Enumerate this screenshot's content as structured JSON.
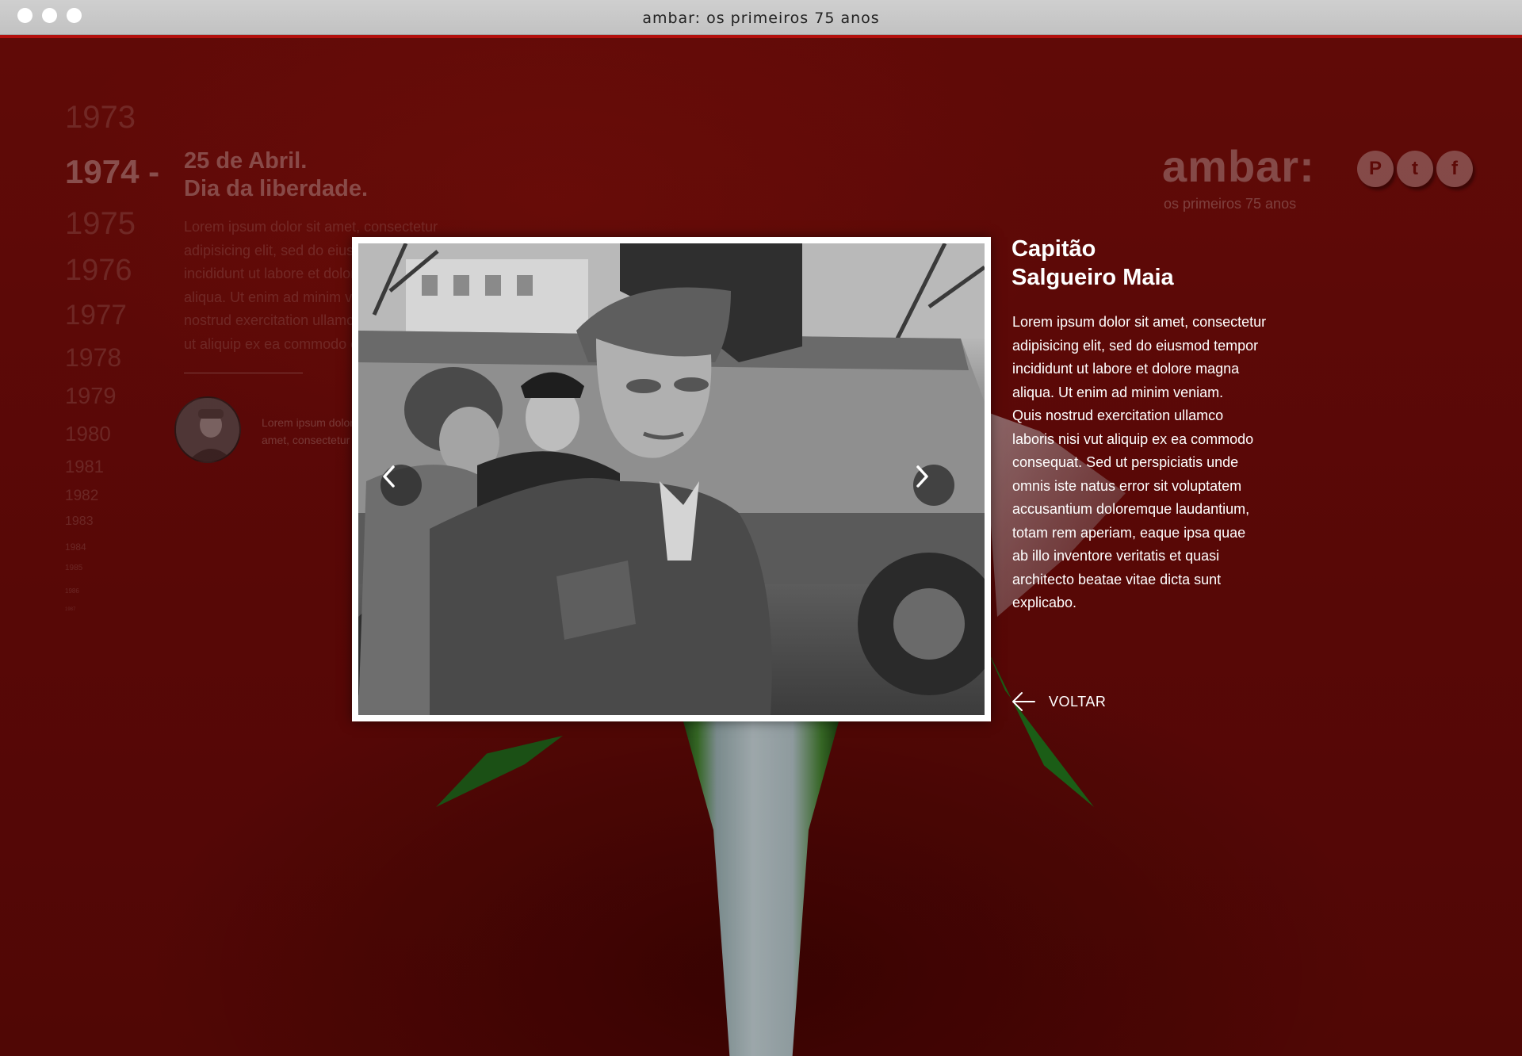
{
  "window": {
    "title": "ambar: os primeiros 75 anos"
  },
  "timeline": {
    "years": [
      "1973",
      "1974 -",
      "1975",
      "1976",
      "1977",
      "1978",
      "1979",
      "1980",
      "1981",
      "1982",
      "1983",
      "1984",
      "1985",
      "1986",
      "1987"
    ],
    "active_index": 1
  },
  "event": {
    "title_line1": "25 de Abril.",
    "title_line2": "Dia da liberdade.",
    "text_lines": [
      "Lorem ipsum dolor sit amet, consectetur",
      "adipisicing elit, sed do eiusmod tempor",
      "incididunt ut labore et dolore magna",
      "aliqua. Ut enim ad minim veniam,",
      "nostrud exercitation ullamco laboris",
      "ut aliquip ex ea commodo consequat."
    ],
    "thumb_caption_line1": "Lorem ipsum dolor sit",
    "thumb_caption_line2": "amet, consectetur"
  },
  "brand": {
    "name": "ambar:",
    "tagline": "os primeiros 75 anos"
  },
  "social": [
    {
      "name": "pinterest-icon",
      "glyph": "P"
    },
    {
      "name": "twitter-icon",
      "glyph": "t"
    },
    {
      "name": "facebook-icon",
      "glyph": "f"
    }
  ],
  "detail": {
    "title_line1": "Capitão",
    "title_line2": "Salgueiro Maia",
    "text_lines": [
      "Lorem ipsum dolor sit amet, consectetur",
      "adipisicing elit, sed do eiusmod tempor",
      "incididunt ut labore et dolore magna",
      "aliqua. Ut enim ad minim veniam.",
      "Quis nostrud exercitation ullamco",
      "laboris nisi  vut aliquip ex ea commodo",
      "consequat. Sed ut perspiciatis unde",
      "omnis iste natus error sit voluptatem",
      "accusantium doloremque laudantium,",
      "totam rem aperiam, eaque ipsa quae",
      "ab illo inventore veritatis et quasi",
      "architecto beatae vitae dicta sunt",
      "explicabo."
    ],
    "back_label": "VOLTAR"
  },
  "colors": {
    "background": "#6b0b08",
    "accent": "#b20f0c",
    "text": "#ffffff"
  }
}
